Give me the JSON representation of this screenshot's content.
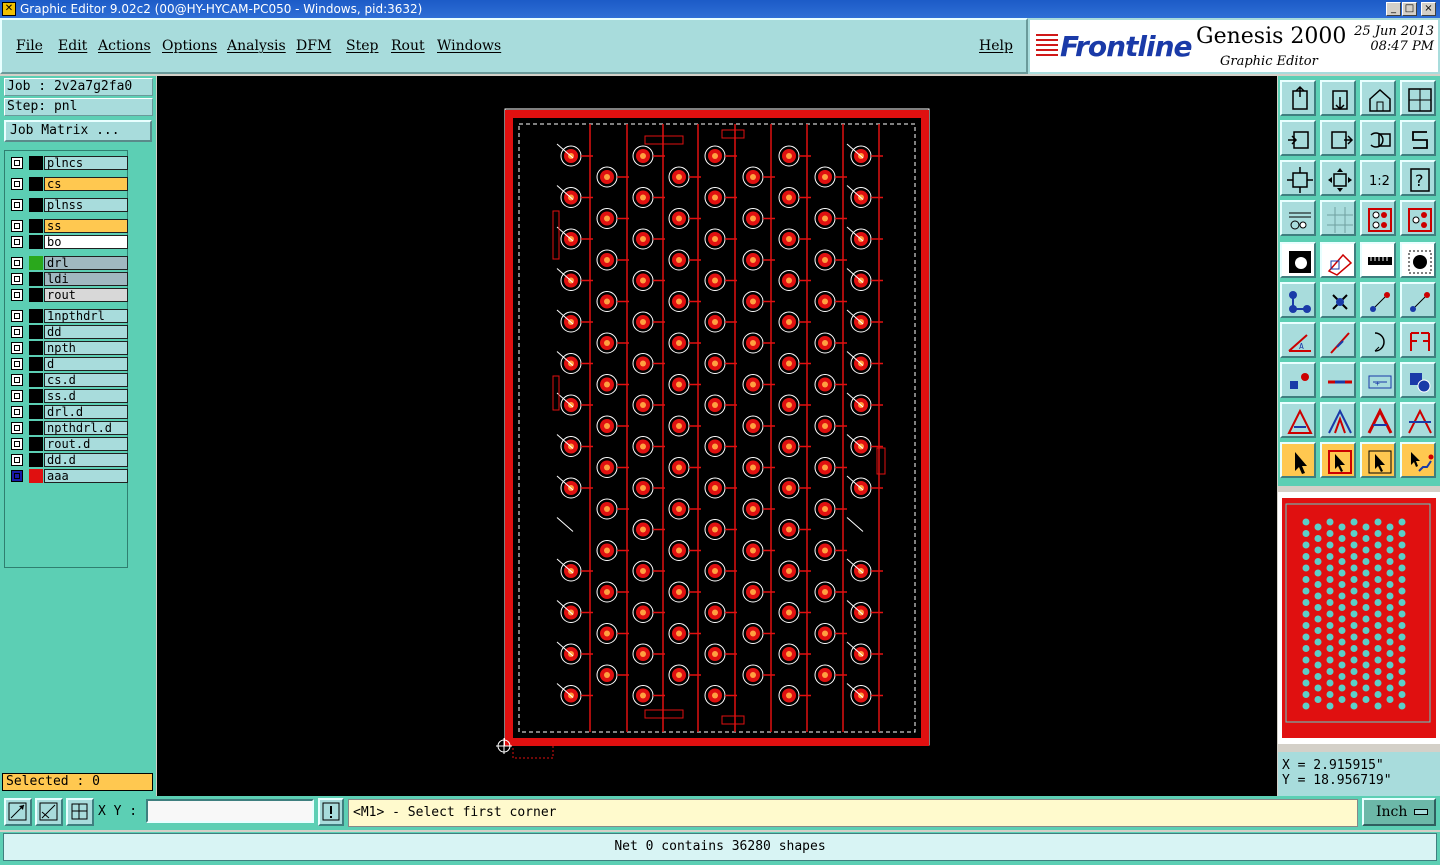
{
  "window": {
    "title": "Graphic Editor 9.02c2 (00@HY-HYCAM-PC050 - Windows, pid:3632)"
  },
  "menu": {
    "items": [
      "File",
      "Edit",
      "Actions",
      "Options",
      "Analysis",
      "DFM",
      "Step",
      "Rout",
      "Windows"
    ],
    "help": "Help"
  },
  "brand": {
    "logo": "Frontline",
    "product": "Genesis 2000",
    "subtitle": "Graphic Editor",
    "date": "25 Jun 2013",
    "time": "08:47 PM"
  },
  "job": {
    "job_label": "Job : 2v2a7g2fa0",
    "step_label": "Step: pnl",
    "matrix_button": "Job Matrix ..."
  },
  "layers": [
    {
      "name": "plncs",
      "color": "#a8dcdc",
      "swatch": "#000000"
    },
    {
      "name": "cs",
      "color": "#ffc850",
      "swatch": "#000000"
    },
    {
      "name": "plnss",
      "color": "#a8dcdc",
      "swatch": "#000000"
    },
    {
      "name": "ss",
      "color": "#ffc850",
      "swatch": "#000000"
    },
    {
      "name": "bo",
      "color": "#ffffff",
      "swatch": "#000000"
    },
    {
      "name": "drl",
      "color": "#a0b8c0",
      "swatch": "#2aa81c"
    },
    {
      "name": "ldi",
      "color": "#a0b8c0",
      "swatch": "#000000"
    },
    {
      "name": "rout",
      "color": "#d8d8d8",
      "swatch": "#000000"
    },
    {
      "name": "1npthdrl",
      "color": "#a8dcdc",
      "swatch": "#000000"
    },
    {
      "name": "dd",
      "color": "#a8dcdc",
      "swatch": "#000000"
    },
    {
      "name": "npth",
      "color": "#a8dcdc",
      "swatch": "#000000"
    },
    {
      "name": "d",
      "color": "#a8dcdc",
      "swatch": "#000000"
    },
    {
      "name": "cs.d",
      "color": "#a8dcdc",
      "swatch": "#000000"
    },
    {
      "name": "ss.d",
      "color": "#a8dcdc",
      "swatch": "#000000"
    },
    {
      "name": "drl.d",
      "color": "#a8dcdc",
      "swatch": "#000000"
    },
    {
      "name": "npthdrl.d",
      "color": "#a8dcdc",
      "swatch": "#000000"
    },
    {
      "name": "rout.d",
      "color": "#a8dcdc",
      "swatch": "#000000"
    },
    {
      "name": "dd.d",
      "color": "#a8dcdc",
      "swatch": "#000000"
    },
    {
      "name": "aaa",
      "color": "#a8dcdc",
      "swatch": "#e01010"
    }
  ],
  "selection": {
    "label": "Selected : 0"
  },
  "coordinates": {
    "x": "X = 2.915915\"",
    "y": "Y = 18.956719\""
  },
  "bottom": {
    "xy_label": "X Y :",
    "xy_value": "",
    "prompt": "<M1> - Select first corner",
    "units": "Inch",
    "status": "Net 0 contains 36280 shapes"
  },
  "toolbar_icons": [
    "layer-up-icon",
    "layer-down-icon",
    "home-icon",
    "window-split-icon",
    "zoom-left-icon",
    "zoom-right-icon",
    "rotate-icon",
    "mirror-icon",
    "zoom-fit-icon",
    "zoom-center-icon",
    "scale-1-2-icon",
    "help-query-icon",
    "measure-tool-icon",
    "grid-icon",
    "snap-pad-icon",
    "snap-pad-red-icon",
    "pad-feature-icon",
    "resize-icon",
    "ruler-icon",
    "dot-select-icon",
    "connect-pads-icon",
    "cross-icon",
    "line-node-icon",
    "line-end-icon",
    "angle-line-icon",
    "diagonal-line-icon",
    "arc-icon",
    "mirror-f-icon",
    "node-icon",
    "horizontal-line-icon",
    "dimension-icon",
    "shapes-icon",
    "triangle-a-icon",
    "triangle-b-icon",
    "triangle-c-icon",
    "triangle-d-icon",
    "pointer-icon",
    "pointer-box-icon",
    "pointer-select-icon",
    "pointer-route-icon"
  ],
  "colors": {
    "panel": "#5ccfb4",
    "button": "#a8dcdc",
    "accent_yellow": "#ffc850",
    "board_red": "#e01010",
    "canvas": "#000000"
  }
}
